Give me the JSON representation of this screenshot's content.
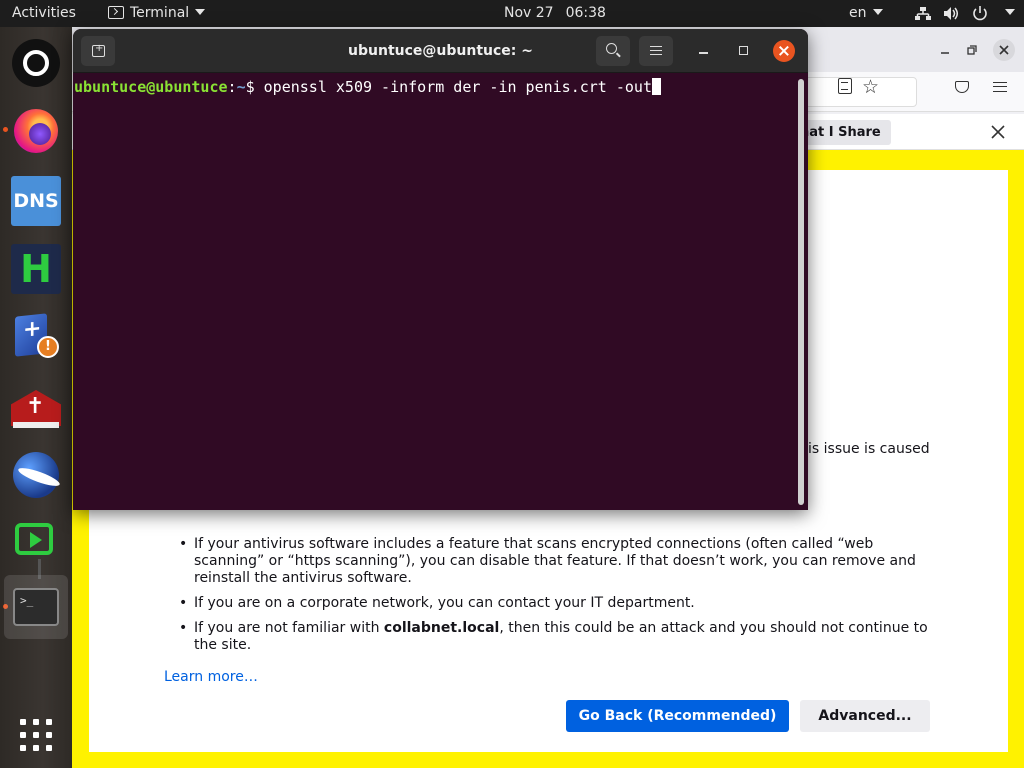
{
  "topbar": {
    "activities": "Activities",
    "app_name": "Terminal",
    "date": "Nov 27",
    "time": "06:38",
    "language": "en"
  },
  "dock": {
    "items": [
      {
        "name": "ubuntu-software"
      },
      {
        "name": "firefox",
        "running": true
      },
      {
        "name": "dns",
        "label": "DNS"
      },
      {
        "name": "hotspot",
        "label": "H"
      },
      {
        "name": "bible-update"
      },
      {
        "name": "bible"
      },
      {
        "name": "globe-app"
      },
      {
        "name": "anydesk"
      },
      {
        "name": "terminal",
        "running": true
      }
    ]
  },
  "firefox": {
    "share_button": "hat I Share",
    "partial_text": "is issue is caused",
    "bullets": [
      {
        "text": "If your antivirus software includes a feature that scans encrypted connections (often called “web scanning” or “https scanning”), you can disable that feature. If that doesn’t work, you can remove and reinstall the antivirus software."
      },
      {
        "text": "If you are on a corporate network, you can contact your IT department."
      },
      {
        "prefix": "If you are not familiar with ",
        "bold": "collabnet.local",
        "suffix": ", then this could be an attack and you should not continue to the site."
      }
    ],
    "learn_more": "Learn more…",
    "go_back": "Go Back (Recommended)",
    "advanced": "Advanced..."
  },
  "terminal": {
    "title": "ubuntuce@ubuntuce: ~",
    "prompt_user": "ubuntuce@ubuntuce",
    "prompt_sep": ":",
    "prompt_path": "~",
    "prompt_symbol": "$ ",
    "command": "openssl x509 -inform der -in penis.crt -out"
  },
  "colors": {
    "terminal_bg": "#300a24",
    "prompt_user": "#8ae234",
    "prompt_path": "#729fcf",
    "accent": "#e95420",
    "firefox_warning_border": "#fff200",
    "firefox_primary": "#0061e0"
  }
}
